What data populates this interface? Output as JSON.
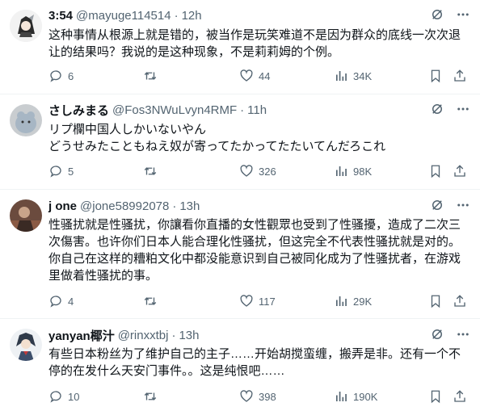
{
  "posts": [
    {
      "name": "3:54",
      "handle": "@mayuge114514",
      "time": "12h",
      "text": "这种事情从根源上就是错的，被当作是玩笑难道不是因为群众的底线一次次退让的结果吗？我说的是这种现象，不是莉莉姆的个例。",
      "replies": "6",
      "retweets": "",
      "likes": "44",
      "views": "34K",
      "avatar_icon": "anime-avatar-icon"
    },
    {
      "name": "さしみまる",
      "handle": "@Fos3NWuLvyn4RMF",
      "time": "11h",
      "text": "リプ欄中国人しかいないやん\nどうせみたこともねえ奴が寄ってたかってたたいてんだろこれ",
      "replies": "5",
      "retweets": "",
      "likes": "326",
      "views": "98K",
      "avatar_icon": "plush-toy-avatar-icon"
    },
    {
      "name": "j one",
      "handle": "@jone58992078",
      "time": "13h",
      "text": "性骚扰就是性骚扰，你讓看你直播的女性觀眾也受到了性骚擾，造成了二次三次傷害。也许你们日本人能合理化性骚扰，但这完全不代表性骚扰就是对的。你自己在这样的糟粕文化中都没能意识到自己被同化成为了性骚扰者，在游戏里做着性骚扰的事。",
      "replies": "4",
      "retweets": "",
      "likes": "117",
      "views": "29K",
      "avatar_icon": "photo-avatar-icon"
    },
    {
      "name": "yanyan椰汁",
      "handle": "@rinxxtbj",
      "time": "13h",
      "text": "有些日本粉丝为了维护自己的主子……开始胡搅蛮缠，搬弄是非。还有一个不停的在发什么天安门事件。。这是纯恨吧……",
      "replies": "10",
      "retweets": "",
      "likes": "398",
      "views": "190K",
      "avatar_icon": "anime-character-avatar-icon"
    }
  ],
  "colors": {
    "text": "#0f1419",
    "muted": "#536471",
    "divider": "#eff3f4"
  }
}
